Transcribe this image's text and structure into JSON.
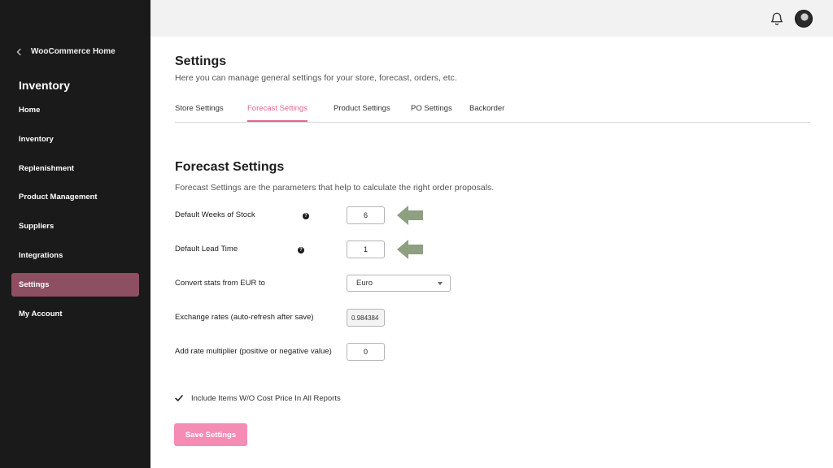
{
  "sidebar": {
    "back_label": "WooCommerce Home",
    "title": "Inventory",
    "items": [
      {
        "label": "Home"
      },
      {
        "label": "Inventory"
      },
      {
        "label": "Replenishment"
      },
      {
        "label": "Product Management"
      },
      {
        "label": "Suppliers"
      },
      {
        "label": "Integrations"
      },
      {
        "label": "Settings",
        "active": true
      },
      {
        "label": "My Account"
      }
    ]
  },
  "topbar": {
    "icons": [
      "bell-icon",
      "user-avatar"
    ]
  },
  "page": {
    "title": "Settings",
    "subtitle": "Here you can manage general settings for your store, forecast, orders, etc."
  },
  "tabs": [
    {
      "label": "Store Settings"
    },
    {
      "label": "Forecast Settings",
      "active": true
    },
    {
      "label": "Product Settings"
    },
    {
      "label": "PO Settings"
    },
    {
      "label": "Backorder"
    }
  ],
  "forecast": {
    "title": "Forecast Settings",
    "description": "Forecast Settings are the parameters that help to calculate the right order proposals.",
    "weeks_of_stock": {
      "label": "Default Weeks of Stock",
      "value": "6"
    },
    "lead_time": {
      "label": "Default Lead Time",
      "value": "1"
    },
    "convert": {
      "label": "Convert stats from EUR to",
      "selected": "Euro"
    },
    "exchange": {
      "label": "Exchange rates (auto-refresh after save)",
      "value": "0.984384"
    },
    "multiplier": {
      "label": "Add rate multiplier (positive or negative value)",
      "value": "0"
    },
    "include_items": {
      "label": "Include Items W/O Cost Price In All Reports",
      "checked": true
    },
    "save_label": "Save Settings"
  },
  "colors": {
    "accent": "#e3648f",
    "button": "#f48cb4",
    "sidebar_bg": "#1a1a1a",
    "sidebar_active": "#8d4f62",
    "arrow": "#8e9f82"
  }
}
